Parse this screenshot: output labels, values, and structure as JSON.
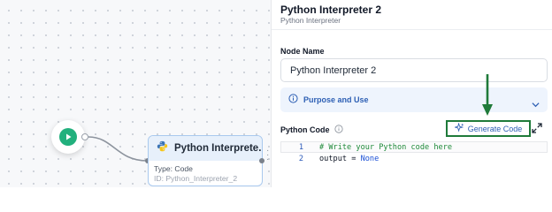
{
  "canvas": {
    "python_node": {
      "title": "Python Interprete...",
      "type_line": "Type: Code",
      "id_line": "ID: Python_Interpreter_2"
    }
  },
  "panel": {
    "title": "Python Interpreter 2",
    "subtitle": "Python Interpreter",
    "node_name_label": "Node Name",
    "node_name_value": "Python Interpreter 2",
    "purpose_label": "Purpose and Use",
    "code_label": "Python Code",
    "generate_code_label": "Generate Code",
    "editor": {
      "lines": [
        {
          "number": "1",
          "comment": "# Write your Python code here"
        },
        {
          "number": "2",
          "lhs": "output = ",
          "keyword": "None"
        }
      ]
    }
  },
  "colors": {
    "accent_blue": "#2d5fb4",
    "start_green": "#22b07d",
    "annotation_green": "#1f7a3a"
  },
  "icons": {
    "start": "play-icon",
    "python": "python-icon",
    "purpose": "info-icon",
    "chevron": "chevron-down-icon",
    "code_help": "help-circle-icon",
    "generate": "sparkle-icon",
    "expand": "expand-icon"
  }
}
